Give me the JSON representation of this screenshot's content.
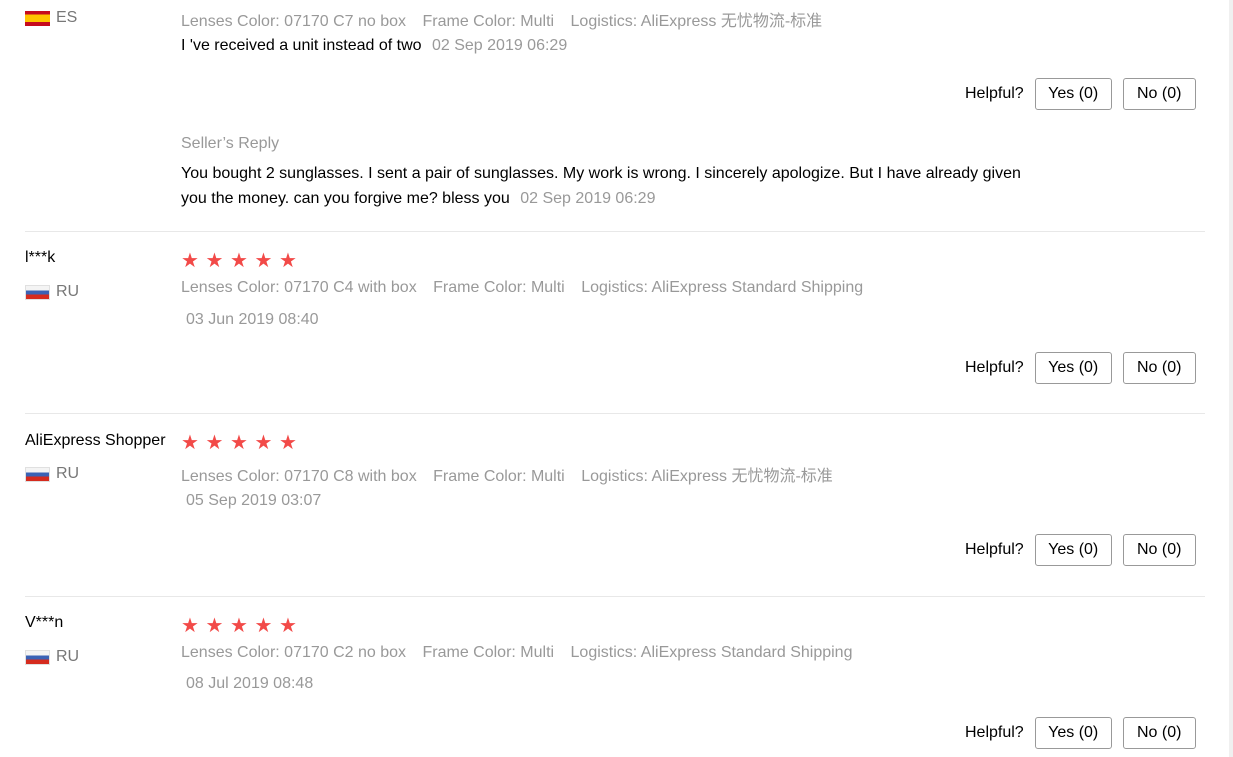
{
  "helpful_label": "Helpful?",
  "reviews": [
    {
      "user": "",
      "country": "ES",
      "lenses": "Lenses Color: 07170 C7 no box",
      "frame": "Frame Color: Multi",
      "logistics": "Logistics: AliExpress 无忧物流-标准",
      "feedback": "I 've received a unit instead of two",
      "date": "02 Sep 2019 06:29",
      "yes": "Yes (0)",
      "no": "No (0)",
      "seller_reply": {
        "label": "Seller’s Reply",
        "text": "You bought 2 sunglasses. I sent a pair of sunglasses. My work is wrong. I sincerely apologize. But I have already given you the money. can you forgive me? bless you",
        "date": "02 Sep 2019 06:29"
      }
    },
    {
      "user": "l***k",
      "country": "RU",
      "rating": 5,
      "lenses": "Lenses Color: 07170 C4 with box",
      "frame": "Frame Color: Multi",
      "logistics": "Logistics: AliExpress Standard Shipping",
      "date": "03 Jun 2019 08:40",
      "yes": "Yes (0)",
      "no": "No (0)"
    },
    {
      "user": "AliExpress Shopper",
      "country": "RU",
      "rating": 5,
      "lenses": "Lenses Color: 07170 C8 with box",
      "frame": "Frame Color: Multi",
      "logistics": "Logistics: AliExpress 无忧物流-标准",
      "date": "05 Sep 2019 03:07",
      "yes": "Yes (0)",
      "no": "No (0)"
    },
    {
      "user": "V***n",
      "country": "RU",
      "rating": 5,
      "lenses": "Lenses Color: 07170 C2 no box",
      "frame": "Frame Color: Multi",
      "logistics": "Logistics: AliExpress Standard Shipping",
      "date": "08 Jul 2019 08:48",
      "yes": "Yes (0)",
      "no": "No (0)"
    }
  ],
  "colors": {
    "star": "#f24a48",
    "meta_text": "#999999",
    "divider": "#e8e8e8"
  }
}
